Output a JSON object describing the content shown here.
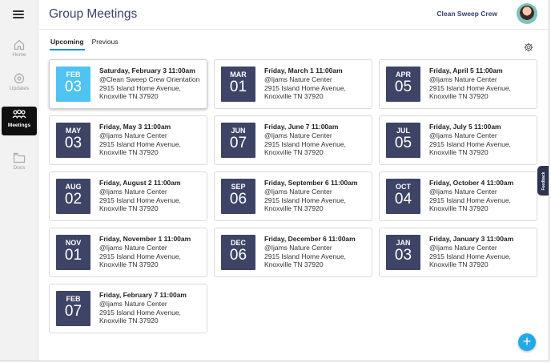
{
  "header": {
    "title": "Group Meetings",
    "team_name": "Clean Sweep Crew"
  },
  "sidebar": {
    "items": [
      {
        "label": "Home",
        "icon": "home-icon",
        "active": false
      },
      {
        "label": "Updates",
        "icon": "updates-icon",
        "active": false
      },
      {
        "label": "Meetings",
        "icon": "meetings-icon",
        "active": true
      },
      {
        "label": "Docs",
        "icon": "docs-icon",
        "active": false
      }
    ]
  },
  "tabs": [
    {
      "label": "Upcoming",
      "active": true
    },
    {
      "label": "Previous",
      "active": false
    }
  ],
  "meetings": [
    {
      "month": "FEB",
      "day": "03",
      "datetime": "Saturday, February 3 11:00am",
      "location": "@Clean Sweep Crew Orientation",
      "address1": "2915 Island Home Avenue,",
      "address2": "Knoxville TN 37920",
      "highlight": true
    },
    {
      "month": "MAR",
      "day": "01",
      "datetime": "Friday, March 1 11:00am",
      "location": "@Ijams Nature Center",
      "address1": "2915 Island Home Avenue,",
      "address2": "Knoxville TN 37920"
    },
    {
      "month": "APR",
      "day": "05",
      "datetime": "Friday, April 5 11:00am",
      "location": "@Ijams Nature Center",
      "address1": "2915 Island Home Avenue,",
      "address2": "Knoxville TN 37920"
    },
    {
      "month": "MAY",
      "day": "03",
      "datetime": "Friday, May 3 11:00am",
      "location": "@Ijams Nature Center",
      "address1": "2915 Island Home Avenue,",
      "address2": "Knoxville TN 37920"
    },
    {
      "month": "JUN",
      "day": "07",
      "datetime": "Friday, June 7 11:00am",
      "location": "@Ijams Nature Center",
      "address1": "2915 Island Home Avenue,",
      "address2": "Knoxville TN 37920"
    },
    {
      "month": "JUL",
      "day": "05",
      "datetime": "Friday, July 5 11:00am",
      "location": "@Ijams Nature Center",
      "address1": "2915 Island Home Avenue,",
      "address2": "Knoxville TN 37920"
    },
    {
      "month": "AUG",
      "day": "02",
      "datetime": "Friday, August 2 11:00am",
      "location": "@Ijams Nature Center",
      "address1": "2915 Island Home Avenue,",
      "address2": "Knoxville TN 37920"
    },
    {
      "month": "SEP",
      "day": "06",
      "datetime": "Friday, September 6 11:00am",
      "location": "@Ijams Nature Center",
      "address1": "2915 Island Home Avenue,",
      "address2": "Knoxville TN 37920"
    },
    {
      "month": "OCT",
      "day": "04",
      "datetime": "Friday, October 4 11:00am",
      "location": "@Ijams Nature Center",
      "address1": "2915 Island Home Avenue,",
      "address2": "Knoxville TN 37920"
    },
    {
      "month": "NOV",
      "day": "01",
      "datetime": "Friday, November 1 11:00am",
      "location": "@Ijams Nature Center",
      "address1": "2915 Island Home Avenue,",
      "address2": "Knoxville TN 37920"
    },
    {
      "month": "DEC",
      "day": "06",
      "datetime": "Friday, December 6 11:00am",
      "location": "@Ijams Nature Center",
      "address1": "2915 Island Home Avenue,",
      "address2": "Knoxville TN 37920"
    },
    {
      "month": "JAN",
      "day": "03",
      "datetime": "Friday, January 3 11:00am",
      "location": "@Ijams Nature Center",
      "address1": "2915 Island Home Avenue,",
      "address2": "Knoxville TN 37920"
    },
    {
      "month": "FEB",
      "day": "07",
      "datetime": "Friday, February 7 11:00am",
      "location": "@Ijams Nature Center",
      "address1": "2915 Island Home Avenue,",
      "address2": "Knoxville TN 37920"
    }
  ],
  "feedback_label": "Feedback",
  "colors": {
    "date_box": "#3d4466",
    "date_box_highlight": "#4fc3f2",
    "accent": "#1e8fd8",
    "fab": "#23a9e8"
  }
}
